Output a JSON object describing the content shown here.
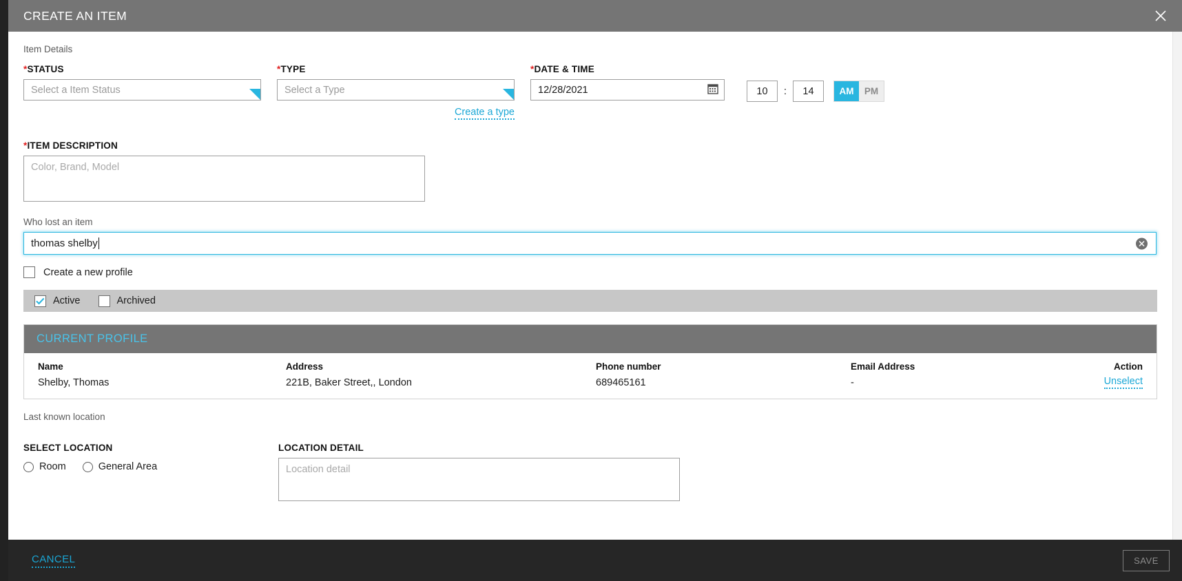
{
  "window": {
    "title": "CREATE AN ITEM",
    "close_icon": "close-icon"
  },
  "form": {
    "section_caption": "Item Details",
    "status": {
      "label": "STATUS",
      "required_marker": "*",
      "placeholder": "Select a Item Status",
      "value": ""
    },
    "type": {
      "label": "TYPE",
      "required_marker": "*",
      "placeholder": "Select a Type",
      "value": "",
      "create_link": "Create a type"
    },
    "datetime": {
      "label": "DATE & TIME",
      "required_marker": "*",
      "date_value": "12/28/2021",
      "calendar_icon": "calendar-icon",
      "hour": "10",
      "separator": ":",
      "minute": "14",
      "meridiem_options": [
        "AM",
        "PM"
      ],
      "meridiem_selected": "AM"
    },
    "item_description": {
      "label": "ITEM DESCRIPTION",
      "required_marker": "*",
      "placeholder": "Color, Brand, Model",
      "value": ""
    },
    "who_lost": {
      "label": "Who lost an item",
      "value": "thomas shelby",
      "placeholder": "",
      "clear_icon": "clear-circle-icon"
    },
    "create_profile": {
      "label": "Create a new profile",
      "checked": false
    },
    "filters": [
      {
        "label": "Active",
        "checked": true
      },
      {
        "label": "Archived",
        "checked": false
      }
    ]
  },
  "current_profile": {
    "heading": "CURRENT PROFILE",
    "columns": [
      "Name",
      "Address",
      "Phone number",
      "Email Address",
      "Action"
    ],
    "rows": [
      {
        "name": "Shelby, Thomas",
        "address": "221B, Baker Street,, London",
        "phone": "689465161",
        "email": "-",
        "action": "Unselect"
      }
    ]
  },
  "location": {
    "caption": "Last known location",
    "select_label": "SELECT LOCATION",
    "options": [
      {
        "label": "Room",
        "selected": false
      },
      {
        "label": "General Area",
        "selected": false
      }
    ],
    "detail_label": "LOCATION DETAIL",
    "detail_placeholder": "Location detail",
    "detail_value": ""
  },
  "footer": {
    "cancel_label": "CANCEL",
    "save_label": "SAVE"
  },
  "colors": {
    "accent": "#29b6e0",
    "link": "#1aa7d6",
    "titlebar": "#757575",
    "footer": "#262626",
    "required": "#e02020",
    "statusbar": "#c7c7c7"
  }
}
